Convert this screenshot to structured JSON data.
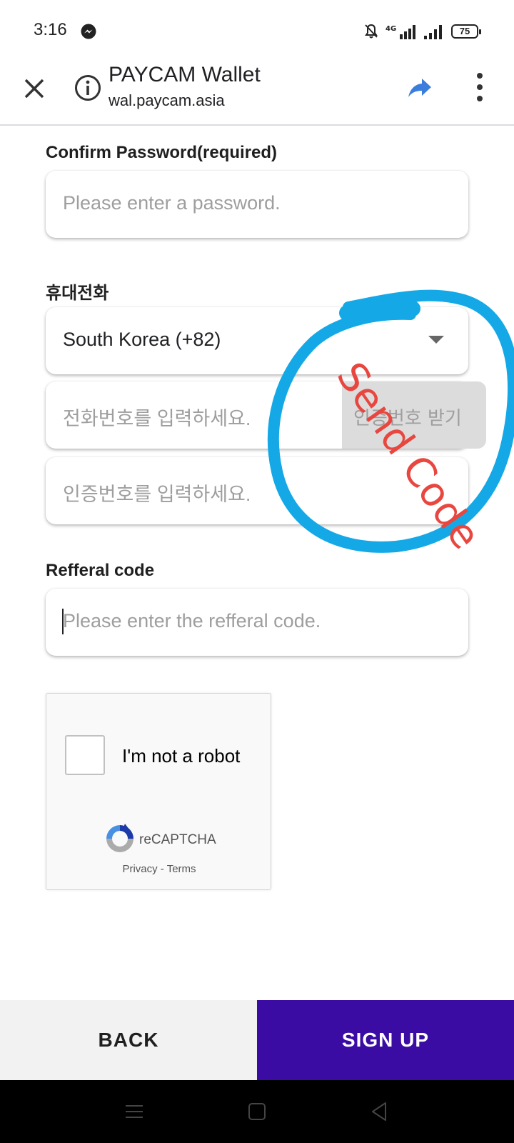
{
  "status_bar": {
    "time": "3:16",
    "battery": "75",
    "network": "4G"
  },
  "browser": {
    "title": "PAYCAM Wallet",
    "url": "wal.paycam.asia"
  },
  "form": {
    "confirm_password": {
      "label": "Confirm Password(required)",
      "placeholder": "Please enter a password."
    },
    "phone": {
      "label": "휴대전화",
      "country": "South Korea (+82)",
      "number_placeholder": "전화번호를 입력하세요.",
      "send_code_label": "인증번호 받기",
      "code_placeholder": "인증번호를 입력하세요."
    },
    "referral": {
      "label": "Refferal code",
      "placeholder": "Please enter the refferal code."
    }
  },
  "recaptcha": {
    "label": "I'm not a robot",
    "brand": "reCAPTCHA",
    "privacy": "Privacy",
    "separator": "-",
    "terms": "Terms"
  },
  "actions": {
    "back": "BACK",
    "signup": "SIGN UP"
  },
  "annotation": {
    "text": "Send Code",
    "circle_color": "#14a9e6",
    "text_color": "#e8463f"
  },
  "colors": {
    "signup_bg": "#3a0ca3",
    "share_icon": "#3b7ddd"
  }
}
